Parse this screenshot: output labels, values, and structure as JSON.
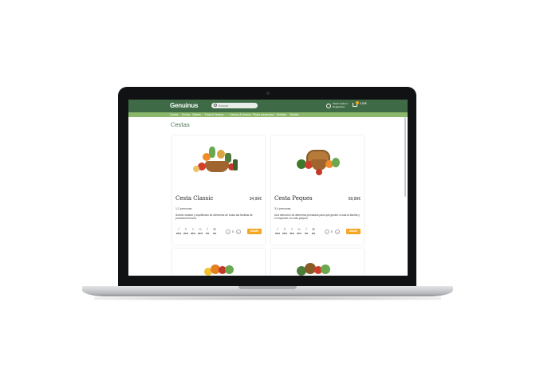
{
  "header": {
    "logo": "Genuinus",
    "search_placeholder": "Buscar",
    "user_text": "Iniciar sesión / Registrarse",
    "cart_price": "0,00€"
  },
  "nav": {
    "items": [
      "Cestas",
      "Envíos",
      "Ofertas",
      "Fruta & Verdura",
      "Lácteos & Huevos",
      "Platos preparados",
      "Bebidas",
      "Bebida"
    ]
  },
  "page": {
    "title": "Cestas"
  },
  "products": [
    {
      "name": "Cesta Classic",
      "price": "34,99€",
      "persons": "1-2 personas",
      "description": "Surtido variado y equilibrado de alimentos de todas las familias de productos frescos.",
      "percents": [
        "20%",
        "20%",
        "30%",
        "20%",
        "0%",
        "0%"
      ],
      "qty": "0",
      "add_label": "Añadir"
    },
    {
      "name": "Cesta Peques",
      "price": "69,99€",
      "persons": "3-4 personas",
      "description": "Una selección de alimentos pensados para que gusten a toda la familia y en especial, los más peques.",
      "percents": [
        "20%",
        "20%",
        "30%",
        "20%",
        "0%",
        "0%"
      ],
      "qty": "0",
      "add_label": "Añadir"
    }
  ],
  "colors": {
    "brand_green": "#3e6b45",
    "nav_green": "#8bb86a",
    "accent_orange": "#f5a623"
  },
  "icons": [
    "search-icon",
    "user-icon",
    "cart-icon",
    "carrot-icon",
    "drop-icon",
    "egg-icon",
    "fish-icon",
    "leaf-icon",
    "bread-icon"
  ]
}
